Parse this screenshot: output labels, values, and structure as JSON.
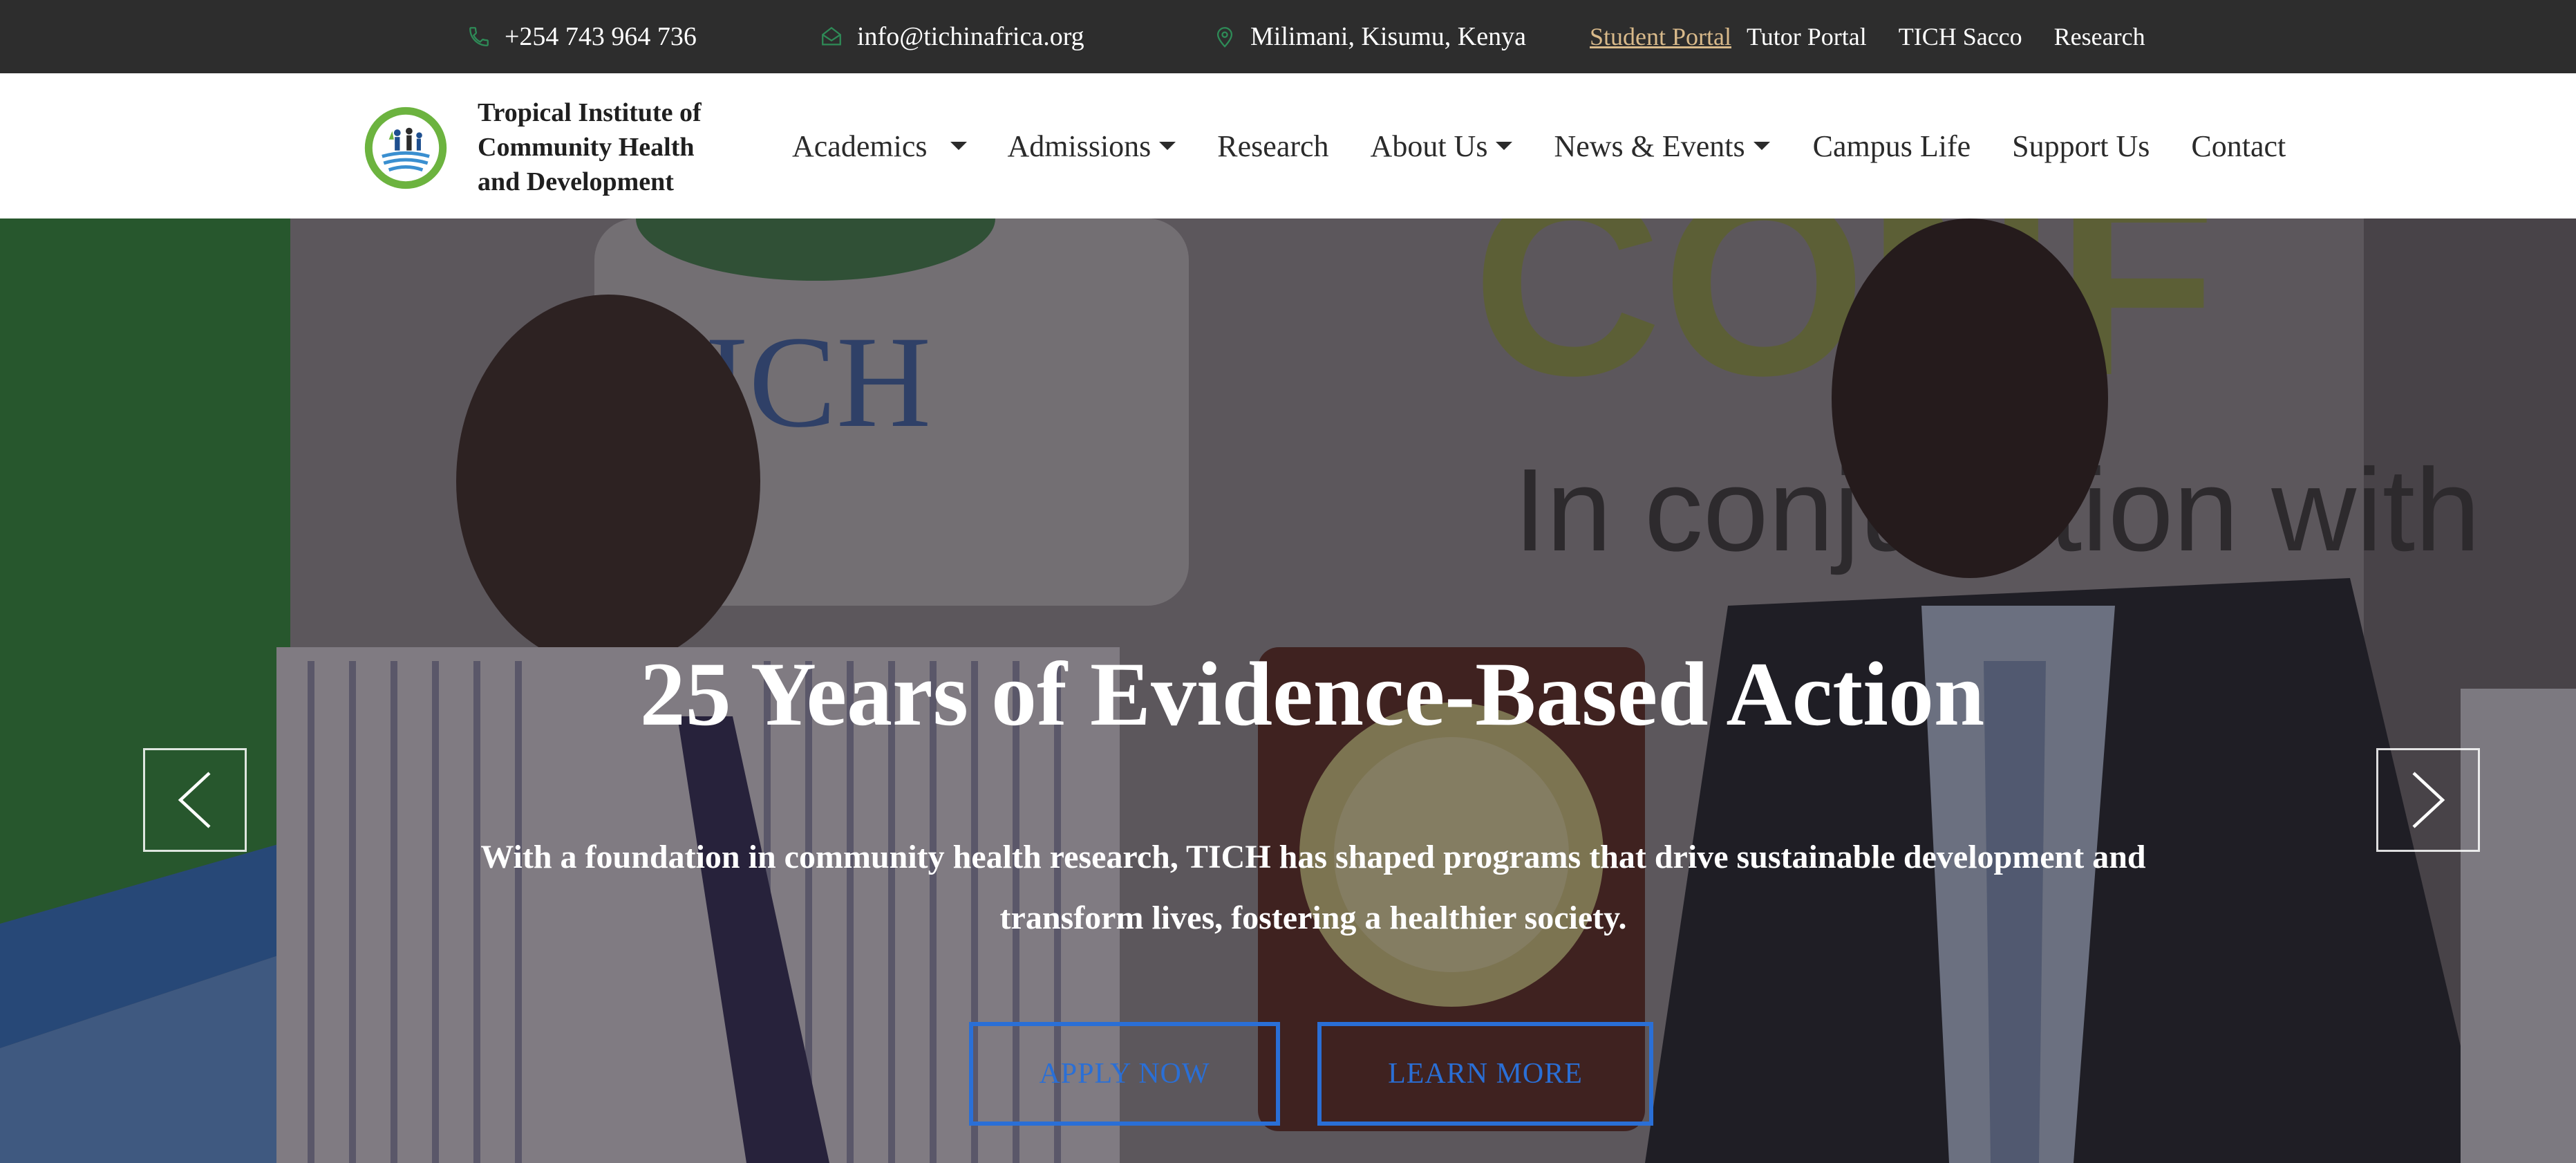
{
  "topbar": {
    "phone": "+254 743 964 736",
    "email": "info@tichinafrica.org",
    "location": "Milimani, Kisumu, Kenya",
    "links": [
      "Student Portal",
      "Tutor Portal",
      "TICH Sacco",
      "Research"
    ],
    "active_link": "Student Portal"
  },
  "brand": {
    "name_line1": "Tropical Institute of",
    "name_line2": "Community Health",
    "name_line3": "and Development"
  },
  "nav": {
    "items": [
      {
        "label": "Academics",
        "dropdown": true
      },
      {
        "label": "Admissions",
        "dropdown": true
      },
      {
        "label": "Research",
        "dropdown": false
      },
      {
        "label": "About Us",
        "dropdown": true
      },
      {
        "label": "News & Events",
        "dropdown": true
      },
      {
        "label": "Campus Life",
        "dropdown": false
      },
      {
        "label": "Support Us",
        "dropdown": false
      },
      {
        "label": "Contact",
        "dropdown": false
      }
    ]
  },
  "hero": {
    "title": "25 Years of Evidence-Based Action",
    "subtitle_line1": "With a foundation in community health research, TICH has shaped programs that drive sustainable development and",
    "subtitle_line2": "transform lives, fostering a healthier society.",
    "apply_label": "APPLY NOW",
    "learn_label": "LEARN MORE",
    "backdrop_text_1": "ICH",
    "backdrop_text_2": "CONF",
    "backdrop_text_3": "In conjunction with"
  },
  "colors": {
    "topbar_bg": "#2d2d2d",
    "icon_green": "#2e8b57",
    "active_link": "#d8b98a",
    "cta_blue": "#2a6fd6",
    "brand_green": "#6cb33f"
  },
  "icons": {
    "phone": "phone-icon",
    "email": "envelope-icon",
    "location": "map-pin-icon",
    "prev": "chevron-left-icon",
    "next": "chevron-right-icon"
  }
}
